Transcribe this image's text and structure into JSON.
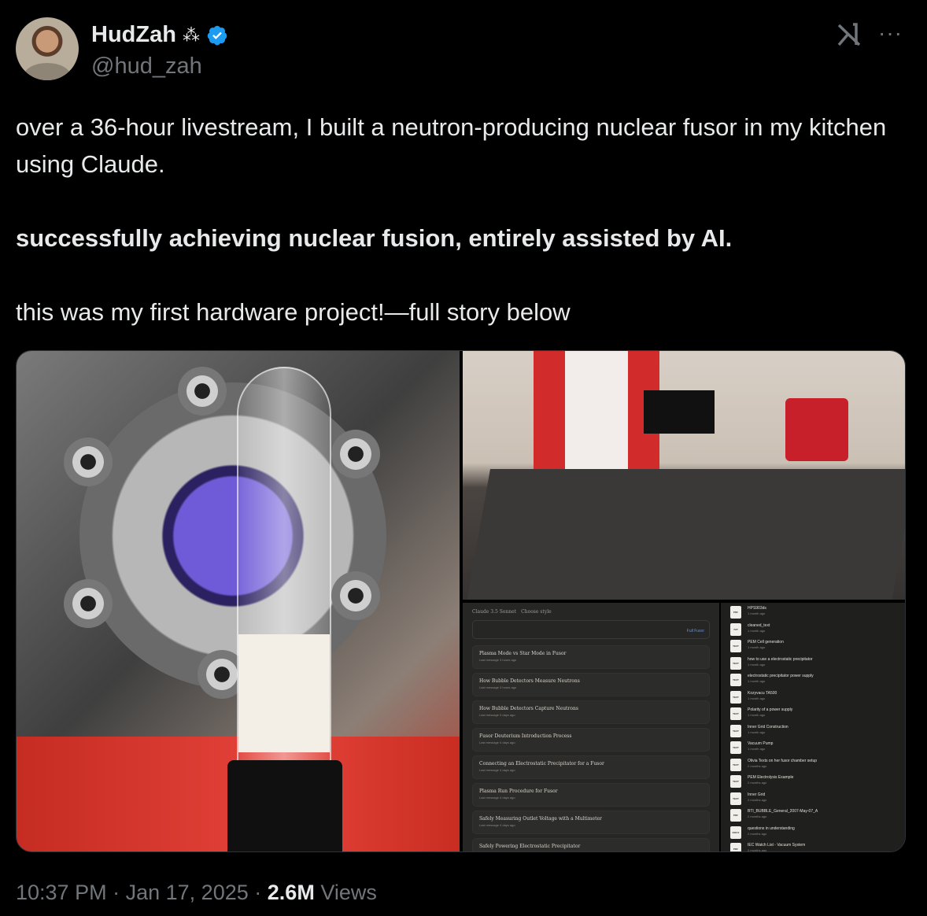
{
  "author": {
    "display_name": "HudZah",
    "handle": "@hud_zah",
    "badge_icon": "sparkle-icon",
    "verified_color": "#1d9bf0"
  },
  "tweet": {
    "line1": "over a 36-hour livestream, I built a neutron-producing nuclear fusor in my kitchen using Claude.",
    "line2": "successfully achieving nuclear fusion, entirely assisted by AI.",
    "line3": "this was my first hardware project!—full story below"
  },
  "meta": {
    "time": "10:37 PM",
    "sep": "·",
    "date": "Jan 17, 2025",
    "views_count": "2.6M",
    "views_label": "Views"
  },
  "screenshot": {
    "model": "Claude 3.5 Sonnet",
    "style": "Choose style",
    "project_link": "Full Fusor",
    "chats": [
      {
        "title": "Plasma Mode vs Star Mode in Fusor",
        "sub": "Last message 3 hours ago"
      },
      {
        "title": "How Bubble Detectors Measure Neutrons",
        "sub": "Last message 3 hours ago"
      },
      {
        "title": "How Bubble Detectors Capture Neutrons",
        "sub": "Last message 3 days ago"
      },
      {
        "title": "Fusor Deuterium Introduction Process",
        "sub": "Last message 4 days ago"
      },
      {
        "title": "Connecting an Electrostatic Precipitator for a Fusor",
        "sub": "Last message 4 days ago"
      },
      {
        "title": "Plasma Run Procedure for Fusor",
        "sub": "Last message 4 days ago"
      },
      {
        "title": "Safely Measuring Outlet Voltage with a Multimeter",
        "sub": "Last message 4 days ago"
      },
      {
        "title": "Safely Powering Electrostatic Precipitator",
        "sub": ""
      }
    ],
    "files": [
      {
        "type": "PDF",
        "name": "HPS903ds",
        "age": "1 month ago"
      },
      {
        "type": "TXT",
        "name": "cleaned_text",
        "age": "1 month ago"
      },
      {
        "type": "TEXT",
        "name": "PEM Cell generation",
        "age": "1 month ago"
      },
      {
        "type": "TEXT",
        "name": "how to use a electrostatic precipitator",
        "age": "1 month ago"
      },
      {
        "type": "TEXT",
        "name": "electrostatic precipitator power supply",
        "age": "1 month ago"
      },
      {
        "type": "TEXT",
        "name": "Kozyvacu TA500",
        "age": "1 month ago"
      },
      {
        "type": "TEXT",
        "name": "Polarity of a power supply",
        "age": "1 month ago"
      },
      {
        "type": "TEXT",
        "name": "Inner Grid Construction",
        "age": "1 month ago"
      },
      {
        "type": "TEXT",
        "name": "Vacuum Pump",
        "age": "1 month ago"
      },
      {
        "type": "TEXT",
        "name": "Olivia Texts on her fusor chamber setup",
        "age": "2 months ago"
      },
      {
        "type": "TEXT",
        "name": "PEM Electrolysis Example",
        "age": "2 months ago"
      },
      {
        "type": "TEXT",
        "name": "Inner Grid",
        "age": "2 months ago"
      },
      {
        "type": "PDF",
        "name": "BTI_BUBBLE_General_2007-May-07_A",
        "age": "2 months ago"
      },
      {
        "type": "DOCX",
        "name": "questions in understanding",
        "age": "2 months ago"
      },
      {
        "type": "PDF",
        "name": "IEC Watch List - Vacuum System",
        "age": "2 months ago"
      }
    ]
  }
}
